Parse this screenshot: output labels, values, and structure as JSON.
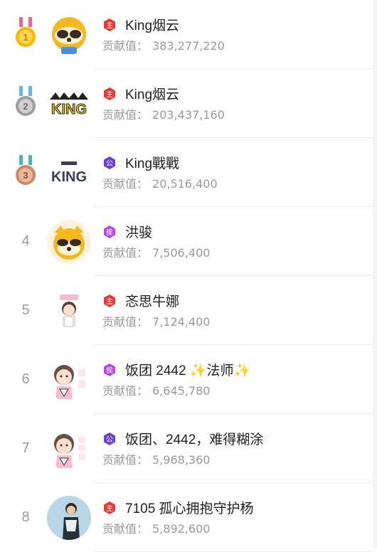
{
  "contribution_label": "贡献值：",
  "rows": [
    {
      "rank": "1",
      "name": "King烟云",
      "value": "383,277,220",
      "badge_text": "主",
      "badge_color": "#e53935",
      "medal": "gold"
    },
    {
      "rank": "2",
      "name": "King烟云",
      "value": "203,437,160",
      "badge_text": "主",
      "badge_color": "#e53935",
      "medal": "silver"
    },
    {
      "rank": "3",
      "name": "King戰戰",
      "value": "20,516,400",
      "badge_text": "公",
      "badge_color": "#6a3fd6",
      "medal": "bronze"
    },
    {
      "rank": "4",
      "name": "洪骏",
      "value": "7,506,400",
      "badge_text": "侯",
      "badge_color": "#b548e6",
      "medal": ""
    },
    {
      "rank": "5",
      "name": "忞思牛娜",
      "value": "7,124,400",
      "badge_text": "主",
      "badge_color": "#e53935",
      "medal": ""
    },
    {
      "rank": "6",
      "name": "饭团 2442 ✨法师✨",
      "value": "6,645,780",
      "badge_text": "侯",
      "badge_color": "#b548e6",
      "medal": ""
    },
    {
      "rank": "7",
      "name": "饭团、2442，难得糊涂",
      "value": "5,968,360",
      "badge_text": "公",
      "badge_color": "#6a3fd6",
      "medal": ""
    },
    {
      "rank": "8",
      "name": "7105 孤心拥抱守护杨",
      "value": "5,892,600",
      "badge_text": "主",
      "badge_color": "#e53935",
      "medal": ""
    }
  ],
  "avatar_texts": {
    "king_logo": "KING"
  }
}
